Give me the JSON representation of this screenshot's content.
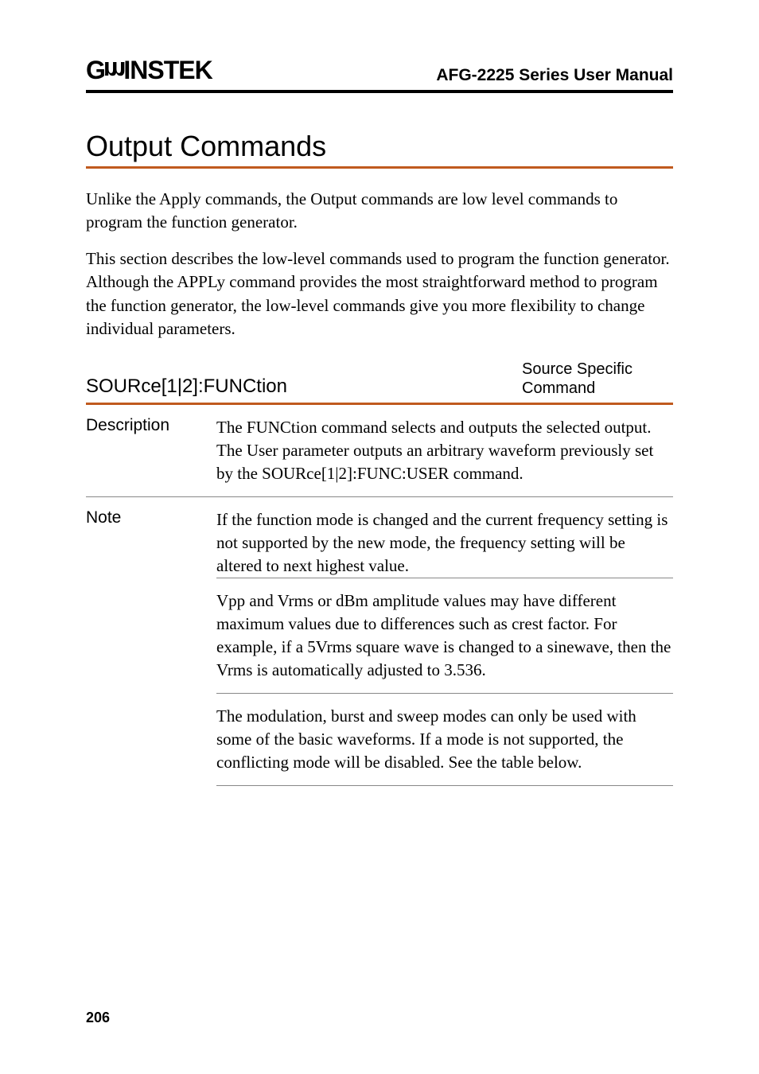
{
  "header": {
    "logo_text": "GWINSTEK",
    "doc_title": "AFG-2225 Series User Manual"
  },
  "title": "Output Commands",
  "intro": [
    "Unlike the Apply commands, the Output commands are low level commands to program the function generator.",
    "This section describes the low-level commands used to program the function generator. Although the APPLy command provides the most straightforward method to program the function generator, the low-level commands give you more flexibility to change individual parameters."
  ],
  "section": {
    "heading": "SOURce[1|2]:FUNCtion",
    "tag_line1": "Source Specific",
    "tag_line2": "Command",
    "rows": [
      {
        "label": "Description",
        "paras": [
          "The FUNCtion command selects and outputs the selected output. The User parameter outputs an arbitrary waveform previously set by the SOURce[1|2]:FUNC:USER command."
        ]
      },
      {
        "label": "Note",
        "paras": [
          "If the function mode is changed and the current frequency setting is not supported by the new mode, the frequency setting will be altered to next highest value.",
          "Vpp and Vrms or dBm amplitude values may have different maximum values due to differences such as crest factor. For example, if a 5Vrms square wave is changed to a sinewave, then the Vrms is automatically adjusted to 3.536.",
          "The modulation, burst and sweep modes can only be used with some of the basic waveforms. If a mode is not supported, the conflicting mode will be disabled. See the table below."
        ]
      }
    ]
  },
  "page_number": "206"
}
